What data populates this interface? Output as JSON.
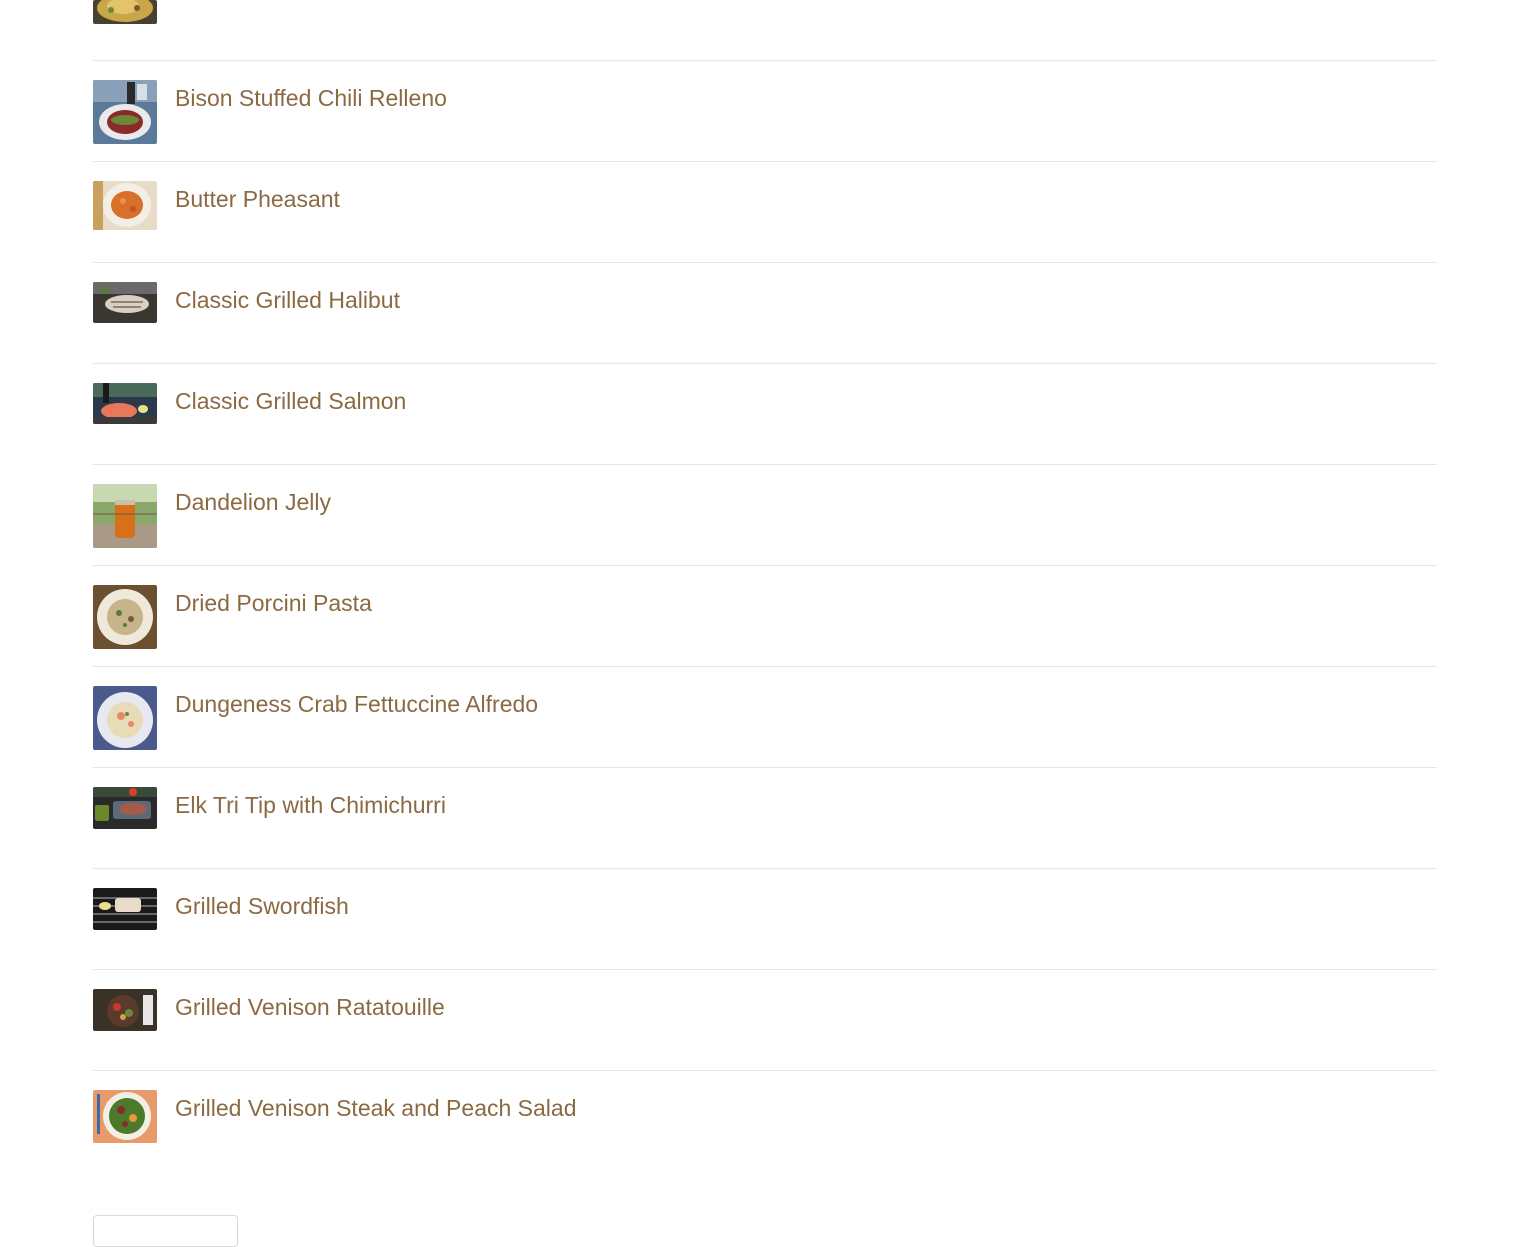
{
  "recipes": [
    {
      "title": "",
      "thumb": "partial-dish-thumbnail"
    },
    {
      "title": "Bison Stuffed Chili Relleno",
      "thumb": "bison-relleno-thumbnail"
    },
    {
      "title": "Butter Pheasant",
      "thumb": "butter-pheasant-thumbnail"
    },
    {
      "title": "Classic Grilled Halibut",
      "thumb": "grilled-halibut-thumbnail"
    },
    {
      "title": "Classic Grilled Salmon",
      "thumb": "grilled-salmon-thumbnail"
    },
    {
      "title": "Dandelion Jelly",
      "thumb": "dandelion-jelly-thumbnail"
    },
    {
      "title": "Dried Porcini Pasta",
      "thumb": "porcini-pasta-thumbnail"
    },
    {
      "title": "Dungeness Crab Fettuccine Alfredo",
      "thumb": "crab-fettuccine-thumbnail"
    },
    {
      "title": "Elk Tri Tip with Chimichurri",
      "thumb": "elk-tri-tip-thumbnail"
    },
    {
      "title": "Grilled Swordfish",
      "thumb": "grilled-swordfish-thumbnail"
    },
    {
      "title": "Grilled Venison Ratatouille",
      "thumb": "venison-ratatouille-thumbnail"
    },
    {
      "title": "Grilled Venison Steak and Peach Salad",
      "thumb": "venison-peach-salad-thumbnail"
    }
  ],
  "colors": {
    "link": "#8b6a43",
    "divider": "#e6e6e6"
  }
}
